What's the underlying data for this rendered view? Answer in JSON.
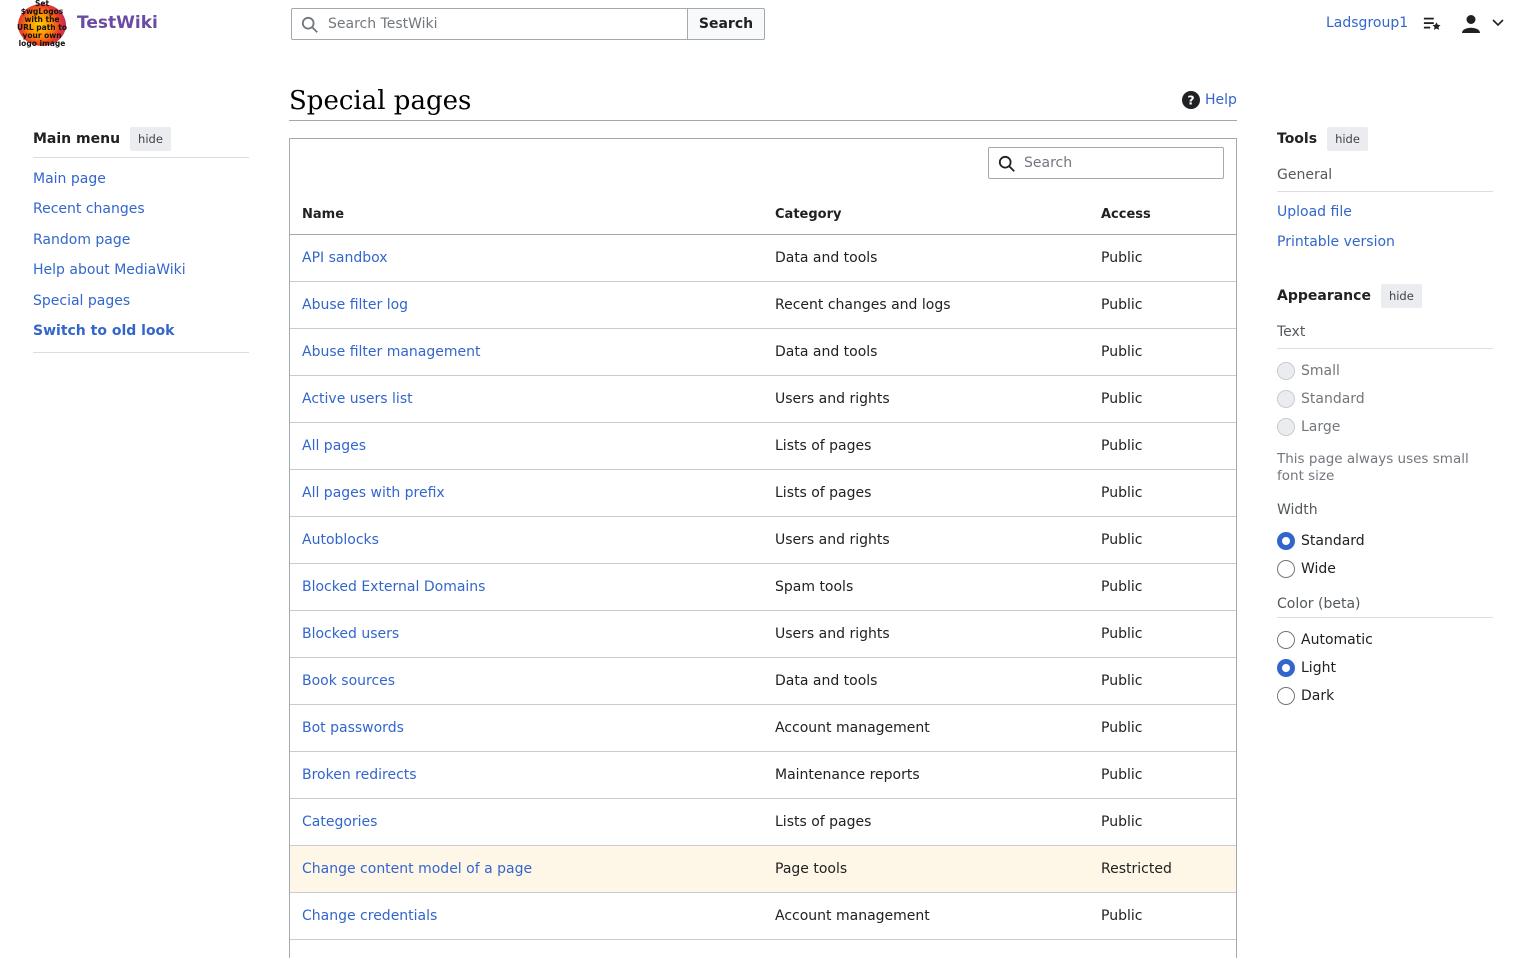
{
  "header": {
    "logo_text": "Set $wgLogos with the URL path to your own logo image",
    "site_name": "TestWiki",
    "search_placeholder": "Search TestWiki",
    "search_button": "Search",
    "username": "Ladsgroup1",
    "watchlist_icon": "watchlist-icon",
    "user_icon": "user-avatar-icon",
    "dropdown_icon": "chevron-down-icon"
  },
  "main_menu": {
    "title": "Main menu",
    "hide_label": "hide",
    "items": [
      {
        "label": "Main page"
      },
      {
        "label": "Recent changes"
      },
      {
        "label": "Random page"
      },
      {
        "label": "Help about MediaWiki"
      },
      {
        "label": "Special pages"
      },
      {
        "label": "Switch to old look"
      }
    ]
  },
  "page": {
    "title": "Special pages",
    "help_label": "Help",
    "filter_placeholder": "Search"
  },
  "table": {
    "headers": {
      "name": "Name",
      "category": "Category",
      "access": "Access"
    },
    "rows": [
      {
        "name": "API sandbox",
        "category": "Data and tools",
        "access": "Public"
      },
      {
        "name": "Abuse filter log",
        "category": "Recent changes and logs",
        "access": "Public"
      },
      {
        "name": "Abuse filter management",
        "category": "Data and tools",
        "access": "Public"
      },
      {
        "name": "Active users list",
        "category": "Users and rights",
        "access": "Public"
      },
      {
        "name": "All pages",
        "category": "Lists of pages",
        "access": "Public"
      },
      {
        "name": "All pages with prefix",
        "category": "Lists of pages",
        "access": "Public"
      },
      {
        "name": "Autoblocks",
        "category": "Users and rights",
        "access": "Public"
      },
      {
        "name": "Blocked External Domains",
        "category": "Spam tools",
        "access": "Public"
      },
      {
        "name": "Blocked users",
        "category": "Users and rights",
        "access": "Public"
      },
      {
        "name": "Book sources",
        "category": "Data and tools",
        "access": "Public"
      },
      {
        "name": "Bot passwords",
        "category": "Account management",
        "access": "Public"
      },
      {
        "name": "Broken redirects",
        "category": "Maintenance reports",
        "access": "Public"
      },
      {
        "name": "Categories",
        "category": "Lists of pages",
        "access": "Public"
      },
      {
        "name": "Change content model of a page",
        "category": "Page tools",
        "access": "Restricted"
      },
      {
        "name": "Change credentials",
        "category": "Account management",
        "access": "Public"
      }
    ]
  },
  "tools": {
    "title": "Tools",
    "hide_label": "hide",
    "general_label": "General",
    "items": [
      {
        "label": "Upload file"
      },
      {
        "label": "Printable version"
      }
    ]
  },
  "appearance": {
    "title": "Appearance",
    "hide_label": "hide",
    "text_label": "Text",
    "text_options": [
      {
        "label": "Small",
        "checked": false,
        "disabled": true
      },
      {
        "label": "Standard",
        "checked": false,
        "disabled": true
      },
      {
        "label": "Large",
        "checked": false,
        "disabled": true
      }
    ],
    "text_note": "This page always uses small font size",
    "width_label": "Width",
    "width_options": [
      {
        "label": "Standard",
        "checked": true
      },
      {
        "label": "Wide",
        "checked": false
      }
    ],
    "color_label": "Color (beta)",
    "color_options": [
      {
        "label": "Automatic",
        "checked": false
      },
      {
        "label": "Light",
        "checked": true
      },
      {
        "label": "Dark",
        "checked": false
      }
    ]
  },
  "colors": {
    "link": "#3366cc",
    "wordmark": "#6b4ba1",
    "restricted_row": "#fef6e7",
    "radio_checked": "#3366cc"
  }
}
